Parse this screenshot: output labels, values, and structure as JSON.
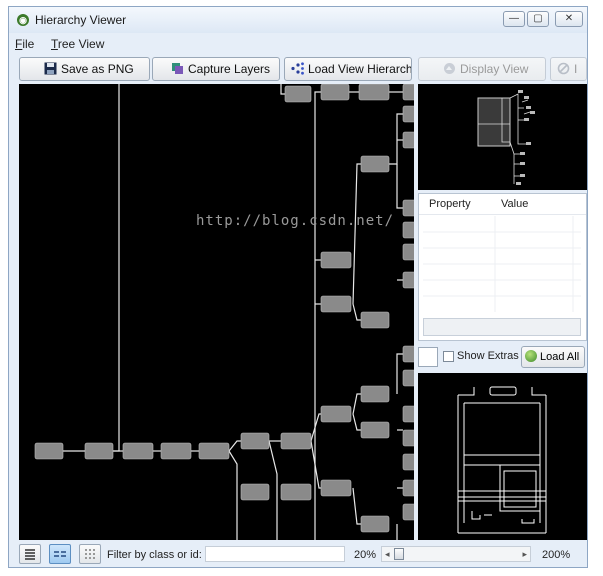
{
  "window": {
    "title": "Hierarchy Viewer",
    "icon": "android-hierarchy-icon",
    "controls": {
      "minimize": "—",
      "maximize": "▢",
      "close": "✕"
    }
  },
  "menu": {
    "items": [
      "File",
      "Tree View"
    ]
  },
  "toolbar": {
    "save_png": "Save as PNG",
    "capture_layers": "Capture Layers",
    "load_view_hierarchy": "Load View Hierarchy",
    "display_view": "Display View",
    "truncated_button": "I"
  },
  "watermark": "http://blog.csdn.net/",
  "properties": {
    "col_property": "Property",
    "col_value": "Value"
  },
  "extras": {
    "show_extras": "Show Extras",
    "show_extras_checked": false,
    "load_all": "Load All"
  },
  "status": {
    "filter_label": "Filter by class or id:",
    "filter_value": "",
    "zoom_min": "20%",
    "zoom_max": "200%",
    "zoom_fraction": 0.0
  },
  "colors": {
    "canvas": "#000000",
    "node": "#8a8a8a",
    "edge": "#e8e8e8",
    "accent": "#5d8fc2"
  }
}
